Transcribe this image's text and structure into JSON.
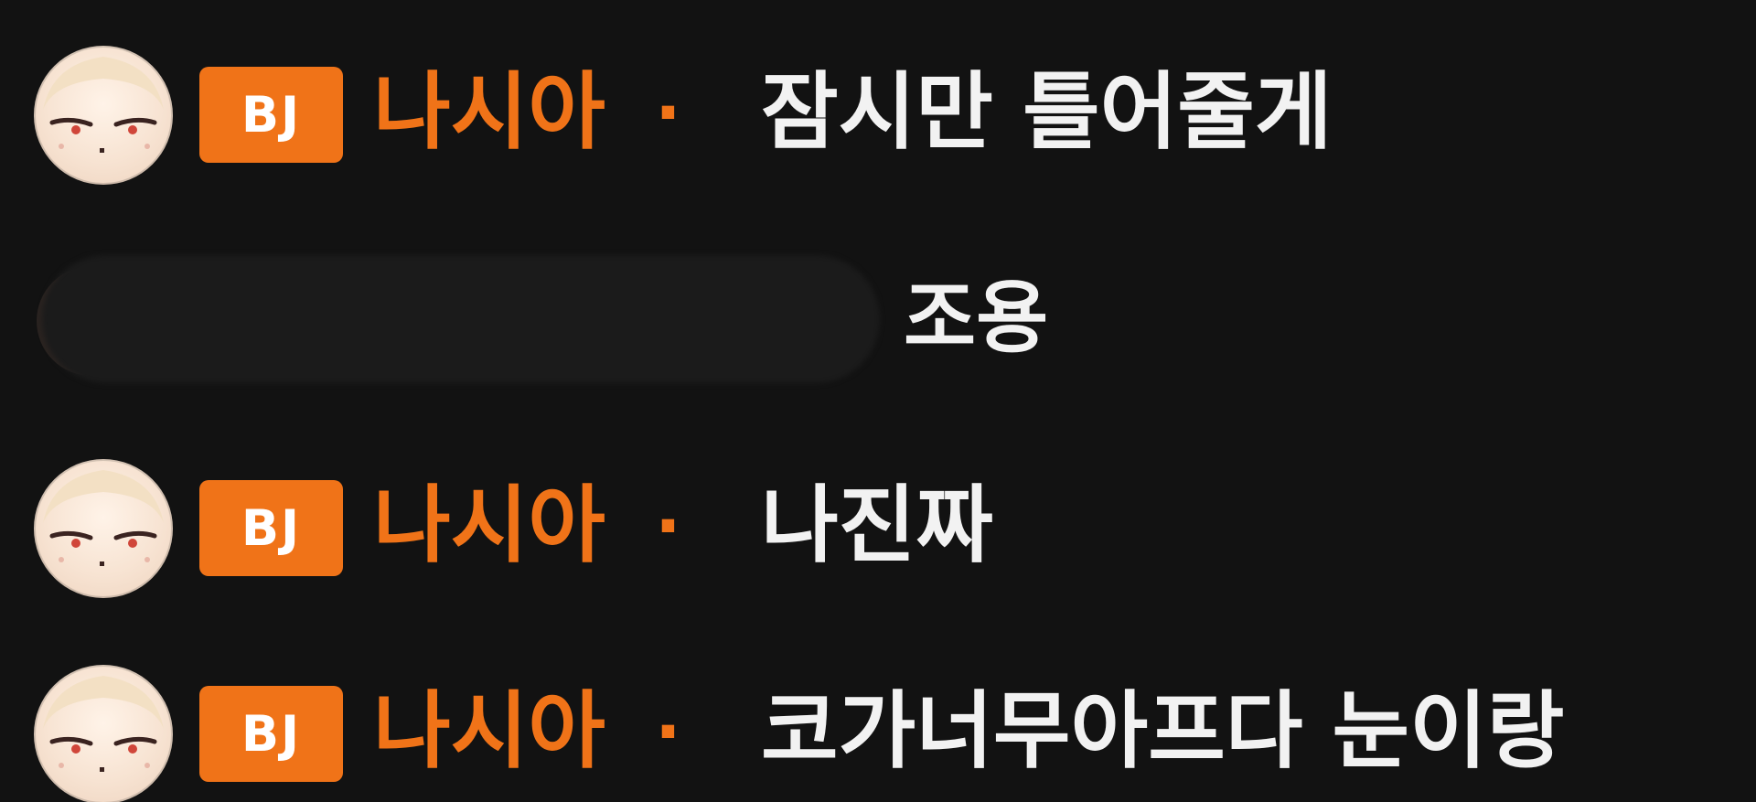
{
  "chat": {
    "messages": [
      {
        "badge": "BJ",
        "nickname": "나시아",
        "separator": "·",
        "text": "잠시만 틀어줄게",
        "avatar_icon": "anime-girl-avatar-icon"
      },
      {
        "redacted": true,
        "text": "조용"
      },
      {
        "badge": "BJ",
        "nickname": "나시아",
        "separator": "·",
        "text": "나진짜",
        "avatar_icon": "anime-girl-avatar-icon"
      },
      {
        "badge": "BJ",
        "nickname": "나시아",
        "separator": "·",
        "text": "코가너무아프다 눈이랑",
        "avatar_icon": "anime-girl-avatar-icon"
      }
    ]
  },
  "colors": {
    "background": "#121212",
    "accent": "#f07318",
    "message_text": "#f2f2f2"
  }
}
